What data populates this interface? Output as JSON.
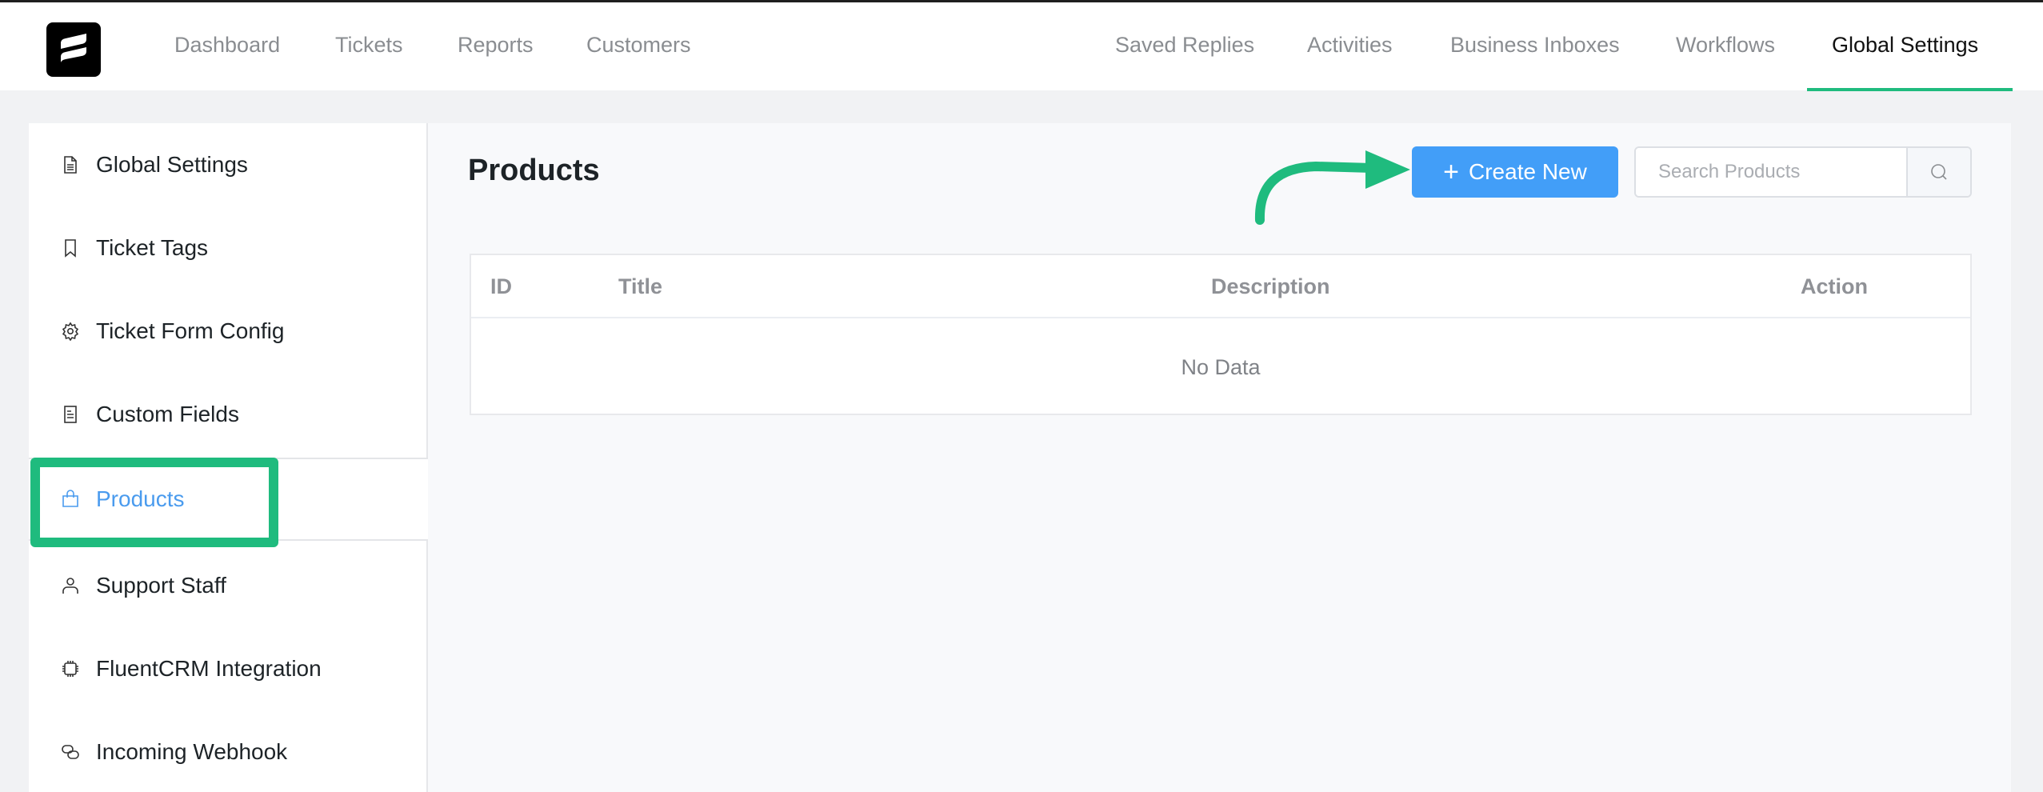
{
  "app": {
    "logo_icon": "fluent-support-logo-icon"
  },
  "nav": {
    "left": [
      {
        "label": "Dashboard"
      },
      {
        "label": "Tickets"
      },
      {
        "label": "Reports"
      },
      {
        "label": "Customers"
      }
    ],
    "right": [
      {
        "label": "Saved Replies"
      },
      {
        "label": "Activities"
      },
      {
        "label": "Business Inboxes"
      },
      {
        "label": "Workflows"
      },
      {
        "label": "Global Settings",
        "active": true
      }
    ]
  },
  "sidebar": {
    "items": [
      {
        "label": "Global Settings",
        "icon": "document-icon"
      },
      {
        "label": "Ticket Tags",
        "icon": "bookmark-icon"
      },
      {
        "label": "Ticket Form Config",
        "icon": "gear-icon"
      },
      {
        "label": "Custom Fields",
        "icon": "list-document-icon"
      },
      {
        "label": "Products",
        "icon": "shopping-bag-icon",
        "active": true
      },
      {
        "label": "Support Staff",
        "icon": "user-icon"
      },
      {
        "label": "FluentCRM Integration",
        "icon": "chip-icon"
      },
      {
        "label": "Incoming Webhook",
        "icon": "webhook-link-icon"
      }
    ]
  },
  "main": {
    "title": "Products",
    "create_button": {
      "label": "Create New",
      "icon": "plus-icon"
    },
    "search": {
      "placeholder": "Search Products",
      "value": "",
      "icon": "search-icon"
    },
    "table": {
      "columns": [
        "ID",
        "Title",
        "Description",
        "Action"
      ],
      "rows": [],
      "empty_text": "No Data"
    }
  },
  "colors": {
    "accent_green": "#1fbb7e",
    "primary_blue": "#429ef8",
    "active_link": "#4a9bee"
  },
  "annotations": {
    "highlight": "sidebar-item-products",
    "arrow_target": "create-new-button"
  }
}
